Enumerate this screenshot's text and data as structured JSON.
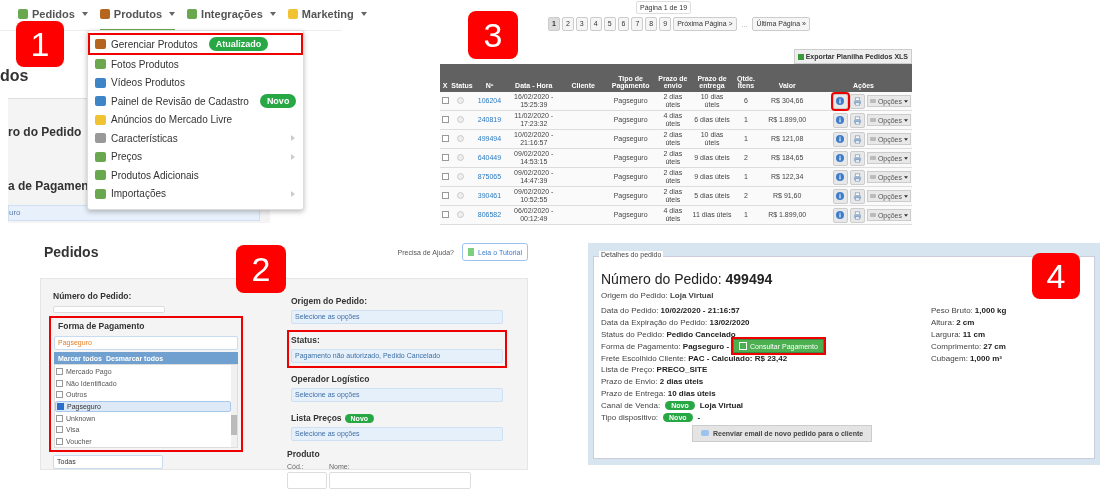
{
  "menu_panel": {
    "badge": "1",
    "nav": [
      {
        "label": "Pedidos",
        "active": false
      },
      {
        "label": "Produtos",
        "active": true
      },
      {
        "label": "Integrações",
        "active": false
      },
      {
        "label": "Marketing",
        "active": false
      }
    ],
    "background_title": "dos",
    "background_headings": [
      "ro do Pedido",
      "a de Pagamen"
    ],
    "background_select": "uro",
    "dropdown": [
      {
        "label": "Gerenciar Produtos",
        "tag": "Atualizado",
        "highlighted": true,
        "submenu": false
      },
      {
        "label": "Fotos Produtos",
        "highlighted": false,
        "submenu": false
      },
      {
        "label": "Vídeos Produtos",
        "highlighted": false,
        "submenu": false
      },
      {
        "label": "Painel de Revisão de Cadastro",
        "tag": "Novo",
        "highlighted": false,
        "submenu": false
      },
      {
        "label": "Anúncios do Mercado Livre",
        "highlighted": false,
        "submenu": false
      },
      {
        "label": "Características",
        "highlighted": false,
        "submenu": true
      },
      {
        "label": "Preços",
        "highlighted": false,
        "submenu": true
      },
      {
        "label": "Produtos Adicionais",
        "highlighted": false,
        "submenu": false
      },
      {
        "label": "Importações",
        "highlighted": false,
        "submenu": true
      }
    ]
  },
  "orders_panel": {
    "badge": "3",
    "page_info": "Página 1 de 19",
    "pages": [
      {
        "label": "1",
        "selected": true
      },
      {
        "label": "2",
        "selected": false
      },
      {
        "label": "3",
        "selected": false
      },
      {
        "label": "4",
        "selected": false
      },
      {
        "label": "5",
        "selected": false
      },
      {
        "label": "6",
        "selected": false
      },
      {
        "label": "7",
        "selected": false
      },
      {
        "label": "8",
        "selected": false
      },
      {
        "label": "9",
        "selected": false
      }
    ],
    "next": "Próxima Página >",
    "ellipsis": "...",
    "last": "Última Página »",
    "export": "Exportar Planilha Pedidos XLS",
    "columns": [
      "X",
      "Status",
      "Nº",
      "Data - Hora",
      "Cliente",
      "Tipo de Pagamento",
      "Prazo de envio",
      "Prazo de entrega",
      "Qtde. Itens",
      "Valor",
      "Ações"
    ],
    "rows": [
      {
        "checked": false,
        "number": "106204",
        "date": "16/02/2020 - 15:25:39",
        "payment": "Pagseguro",
        "shipping": "2 dias úteis",
        "delivery": "10 dias úteis",
        "items": "6",
        "value": "R$ 304,66",
        "options": "Opções",
        "highlighted": true
      },
      {
        "checked": false,
        "number": "240819",
        "date": "11/02/2020 - 17:23:32",
        "payment": "Pagseguro",
        "shipping": "4 dias úteis",
        "delivery": "6 dias úteis",
        "items": "1",
        "value": "R$ 1.899,00",
        "options": "Opções",
        "highlighted": false
      },
      {
        "checked": false,
        "number": "499494",
        "date": "10/02/2020 - 21:16:57",
        "payment": "Pagseguro",
        "shipping": "2 dias úteis",
        "delivery": "10 dias úteis",
        "items": "1",
        "value": "R$ 121,08",
        "options": "Opções",
        "highlighted": false
      },
      {
        "checked": false,
        "number": "640449",
        "date": "09/02/2020 - 14:53:15",
        "payment": "Pagseguro",
        "shipping": "2 dias úteis",
        "delivery": "9 dias úteis",
        "items": "2",
        "value": "R$ 184,65",
        "options": "Opções",
        "highlighted": false
      },
      {
        "checked": false,
        "number": "875065",
        "date": "09/02/2020 - 14:47:39",
        "payment": "Pagseguro",
        "shipping": "2 dias úteis",
        "delivery": "9 dias úteis",
        "items": "1",
        "value": "R$ 122,34",
        "options": "Opções",
        "highlighted": false
      },
      {
        "checked": false,
        "number": "390461",
        "date": "09/02/2020 - 10:52:55",
        "payment": "Pagseguro",
        "shipping": "2 dias úteis",
        "delivery": "5 dias úteis",
        "items": "2",
        "value": "R$ 91,60",
        "options": "Opções",
        "highlighted": false
      },
      {
        "checked": false,
        "number": "806582",
        "date": "06/02/2020 - 00:12:49",
        "payment": "Pagseguro",
        "shipping": "4 dias úteis",
        "delivery": "11 dias úteis",
        "items": "1",
        "value": "R$ 1.899,00",
        "options": "Opções",
        "highlighted": false
      }
    ]
  },
  "filter_panel": {
    "badge": "2",
    "title": "Pedidos",
    "help": "Precisa de Ajuda?",
    "tutorial": "Leia o Tutorial",
    "order_number": {
      "label": "Número do Pedido:"
    },
    "payment": {
      "label": "Forma de Pagamento",
      "highlighted": true,
      "value": "Pagseguro",
      "check_all": "Marcar todos",
      "uncheck_all": "Desmarcar todos",
      "options": [
        {
          "label": "Mercado Pago",
          "checked": false
        },
        {
          "label": "Não Identificado",
          "checked": false
        },
        {
          "label": "Outros",
          "checked": false
        },
        {
          "label": "Pagseguro",
          "checked": true
        },
        {
          "label": "Unknown",
          "checked": false
        },
        {
          "label": "Visa",
          "checked": false
        },
        {
          "label": "Voucher",
          "checked": false
        }
      ],
      "next_select": "Todas"
    },
    "selects": [
      {
        "label": "Origem do Pedido:",
        "value": "Selecione as opções",
        "highlighted": false
      },
      {
        "label": "Status:",
        "value": "Pagamento não autorizado, Pedido Cancelado",
        "highlighted": true
      },
      {
        "label": "Operador Logístico",
        "value": "Selecione as opções",
        "highlighted": false
      },
      {
        "label": "Lista Preços",
        "tag": "Novo",
        "value": "Selecione as opções",
        "highlighted": false
      }
    ],
    "product": {
      "label": "Produto",
      "code": "Cód.:",
      "name": "Nome:"
    }
  },
  "details_panel": {
    "badge": "4",
    "legend": "Detalhes do pedido",
    "title": "Número do Pedido: **499494**",
    "origin": {
      "label": "Origem do Pedido:",
      "value": "Loja Virtual"
    },
    "rows": [
      {
        "label": "Data do Pedido:",
        "value": "10/02/2020 - 21:16:57"
      },
      {
        "label": "Data da Expiração do Pedido:",
        "value": "13/02/2020"
      },
      {
        "label": "Status do Pedido:",
        "value": "Pedido Cancelado"
      },
      {
        "label": "Forma de Pagamento:",
        "value": "Pagseguro -",
        "button": "Consultar Pagamento",
        "highlighted": true
      },
      {
        "label": "Frete Escolhido Cliente:",
        "value": "PAC - Calculado: R$ 23,42"
      },
      {
        "label": "Lista de Preço:",
        "value": "PRECO_SITE"
      },
      {
        "label": "Prazo de Envio:",
        "value": "2 dias úteis"
      },
      {
        "label": "Prazo de Entrega:",
        "value": "10 dias úteis"
      },
      {
        "label": "Canal de Venda:",
        "tag": "Novo",
        "value": "Loja Virtual"
      },
      {
        "label": "Tipo dispositivo:",
        "tag": "Novo",
        "value": "-"
      }
    ],
    "measures": [
      {
        "label": "Peso Bruto:",
        "value": "1,000 kg"
      },
      {
        "label": "Altura:",
        "value": "2 cm"
      },
      {
        "label": "Largura:",
        "value": "11 cm"
      },
      {
        "label": "Comprimento:",
        "value": "27 cm"
      },
      {
        "label": "Cubagem:",
        "value": "1,000 m³"
      }
    ],
    "resend": "Reenviar email de novo pedido para o cliente"
  }
}
